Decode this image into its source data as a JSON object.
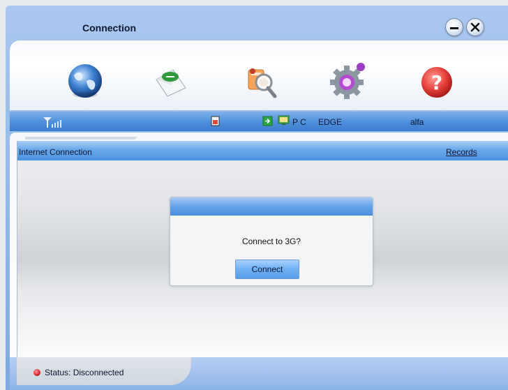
{
  "window": {
    "title": "Connection"
  },
  "toolbar": {
    "items": [
      {
        "icon": "globe-icon",
        "label": "Internet"
      },
      {
        "icon": "sms-envelope-icon",
        "label": "SMS"
      },
      {
        "icon": "contacts-search-icon",
        "label": "Phonebook"
      },
      {
        "icon": "settings-gear-icon",
        "label": "Settings"
      },
      {
        "icon": "help-icon",
        "label": "Help"
      }
    ]
  },
  "status_strip": {
    "mode": "P C",
    "network_type": "EDGE",
    "operator": "alfa"
  },
  "main": {
    "section_title": "Internet Connection",
    "records_link": "Records"
  },
  "dialog": {
    "message": "Connect to 3G?",
    "connect_label": "Connect"
  },
  "footer": {
    "status_text": "Status: Disconnected"
  },
  "colors": {
    "accent_blue": "#4b91df",
    "help_red": "#e8403c",
    "status_red": "#d62a2a"
  }
}
